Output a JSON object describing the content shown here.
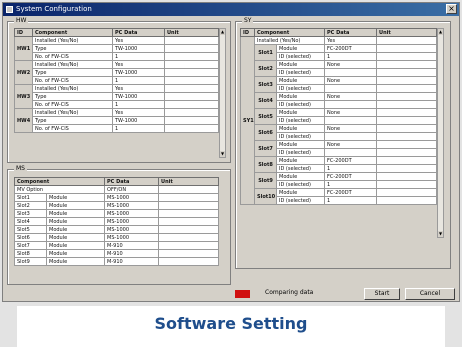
{
  "window": {
    "title": "System Configuration"
  },
  "left_top_group": {
    "title": "HW",
    "headers": [
      "ID",
      "Component",
      "PC Data",
      "Unit"
    ],
    "rows": [
      {
        "id": "HW1",
        "component": "Installed (Yes/No)",
        "pc": "Yes",
        "unit": ""
      },
      {
        "id": "",
        "component": "Type",
        "pc": "TW-1000",
        "unit": ""
      },
      {
        "id": "",
        "component": "No. of FW-CIS",
        "pc": "1",
        "unit": ""
      },
      {
        "id": "HW2",
        "component": "Installed (Yes/No)",
        "pc": "Yes",
        "unit": ""
      },
      {
        "id": "",
        "component": "Type",
        "pc": "TW-1000",
        "unit": ""
      },
      {
        "id": "",
        "component": "No. of FW-CIS",
        "pc": "1",
        "unit": ""
      },
      {
        "id": "HW3",
        "component": "Installed (Yes/No)",
        "pc": "Yes",
        "unit": ""
      },
      {
        "id": "",
        "component": "Type",
        "pc": "TW-1000",
        "unit": ""
      },
      {
        "id": "",
        "component": "No. of FW-CIS",
        "pc": "1",
        "unit": ""
      },
      {
        "id": "HW4",
        "component": "Installed (Yes/No)",
        "pc": "Yes",
        "unit": ""
      },
      {
        "id": "",
        "component": "Type",
        "pc": "TW-1000",
        "unit": ""
      },
      {
        "id": "",
        "component": "No. of FW-CIS",
        "pc": "1",
        "unit": ""
      }
    ]
  },
  "left_bottom_group": {
    "title": "MS",
    "headers": [
      "Component",
      "PC Data",
      "Unit"
    ],
    "rows": [
      {
        "component": "MV Option",
        "pc": "OFF/ON",
        "unit": ""
      },
      {
        "component": "Slot1",
        "sub": "Module",
        "pc": "MS-1000",
        "unit": ""
      },
      {
        "component": "Slot2",
        "sub": "Module",
        "pc": "MS-1000",
        "unit": ""
      },
      {
        "component": "Slot3",
        "sub": "Module",
        "pc": "MS-1000",
        "unit": ""
      },
      {
        "component": "Slot4",
        "sub": "Module",
        "pc": "MS-1000",
        "unit": ""
      },
      {
        "component": "Slot5",
        "sub": "Module",
        "pc": "MS-1000",
        "unit": ""
      },
      {
        "component": "Slot6",
        "sub": "Module",
        "pc": "MS-1000",
        "unit": ""
      },
      {
        "component": "Slot7",
        "sub": "Module",
        "pc": "M-910",
        "unit": ""
      },
      {
        "component": "Slot8",
        "sub": "Module",
        "pc": "M-910",
        "unit": ""
      },
      {
        "component": "Slot9",
        "sub": "Module",
        "pc": "M-910",
        "unit": ""
      }
    ]
  },
  "right_group": {
    "title": "SY",
    "headers": [
      "ID",
      "Component",
      "PC Data",
      "Unit"
    ],
    "rows": [
      {
        "id": "SY1",
        "slot": "",
        "component": "Installed (Yes/No)",
        "pc": "Yes",
        "unit": ""
      },
      {
        "id": "",
        "slot": "Slot1",
        "component": "Module",
        "pc": "FC-200DT",
        "unit": ""
      },
      {
        "id": "",
        "slot": "",
        "component": "ID (selected)",
        "pc": "1",
        "unit": ""
      },
      {
        "id": "",
        "slot": "Slot2",
        "component": "Module",
        "pc": "None",
        "unit": ""
      },
      {
        "id": "",
        "slot": "",
        "component": "ID (selected)",
        "pc": "",
        "unit": ""
      },
      {
        "id": "",
        "slot": "Slot3",
        "component": "Module",
        "pc": "None",
        "unit": ""
      },
      {
        "id": "",
        "slot": "",
        "component": "ID (selected)",
        "pc": "",
        "unit": ""
      },
      {
        "id": "",
        "slot": "Slot4",
        "component": "Module",
        "pc": "None",
        "unit": ""
      },
      {
        "id": "",
        "slot": "",
        "component": "ID (selected)",
        "pc": "",
        "unit": ""
      },
      {
        "id": "",
        "slot": "Slot5",
        "component": "Module",
        "pc": "None",
        "unit": ""
      },
      {
        "id": "",
        "slot": "",
        "component": "ID (selected)",
        "pc": "",
        "unit": ""
      },
      {
        "id": "",
        "slot": "Slot6",
        "component": "Module",
        "pc": "None",
        "unit": ""
      },
      {
        "id": "",
        "slot": "",
        "component": "ID (selected)",
        "pc": "",
        "unit": ""
      },
      {
        "id": "",
        "slot": "Slot7",
        "component": "Module",
        "pc": "None",
        "unit": ""
      },
      {
        "id": "",
        "slot": "",
        "component": "ID (selected)",
        "pc": "",
        "unit": ""
      },
      {
        "id": "",
        "slot": "Slot8",
        "component": "Module",
        "pc": "FC-200DT",
        "unit": ""
      },
      {
        "id": "",
        "slot": "",
        "component": "ID (selected)",
        "pc": "1",
        "unit": ""
      },
      {
        "id": "",
        "slot": "Slot9",
        "component": "Module",
        "pc": "FC-200DT",
        "unit": ""
      },
      {
        "id": "",
        "slot": "",
        "component": "ID (selected)",
        "pc": "1",
        "unit": ""
      },
      {
        "id": "",
        "slot": "Slot10",
        "component": "Module",
        "pc": "FC-200DT",
        "unit": ""
      },
      {
        "id": "",
        "slot": "",
        "component": "ID (selected)",
        "pc": "1",
        "unit": ""
      }
    ]
  },
  "status": {
    "text": "Comparing data",
    "led_color": "#d01010"
  },
  "buttons": {
    "start": "Start",
    "cancel": "Cancel"
  },
  "caption": "Software Setting",
  "colors": {
    "caption": "#1f4e8c",
    "titlebar": "#0a246a"
  }
}
